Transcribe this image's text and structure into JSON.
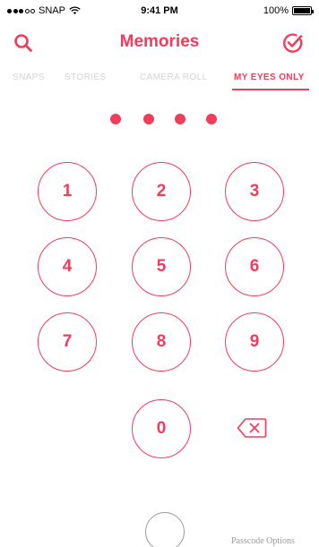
{
  "status_bar": {
    "carrier": "SNAP",
    "time": "9:41 PM",
    "battery": "100%",
    "battery_level": 1.0
  },
  "nav": {
    "title": "Memories",
    "left_icon": "search-icon",
    "right_icon": "select-check-icon"
  },
  "tabs": [
    {
      "label": "SNAPS",
      "active": false
    },
    {
      "label": "STORIES",
      "active": false
    },
    {
      "label": "CAMERA ROLL",
      "active": false
    },
    {
      "label": "MY EYES ONLY",
      "active": true
    }
  ],
  "pin": {
    "entered_digits": 4,
    "total_digits": 4
  },
  "keypad": {
    "keys": [
      "1",
      "2",
      "3",
      "4",
      "5",
      "6",
      "7",
      "8",
      "9",
      "0"
    ],
    "backspace_icon": "backspace-icon"
  },
  "footer": {
    "passcode_options": "Passcode Options"
  },
  "colors": {
    "accent": "#f23c5b",
    "inactive_tab": "#d4d4d4",
    "muted": "#9a9a9a",
    "background": "#ffffff"
  }
}
